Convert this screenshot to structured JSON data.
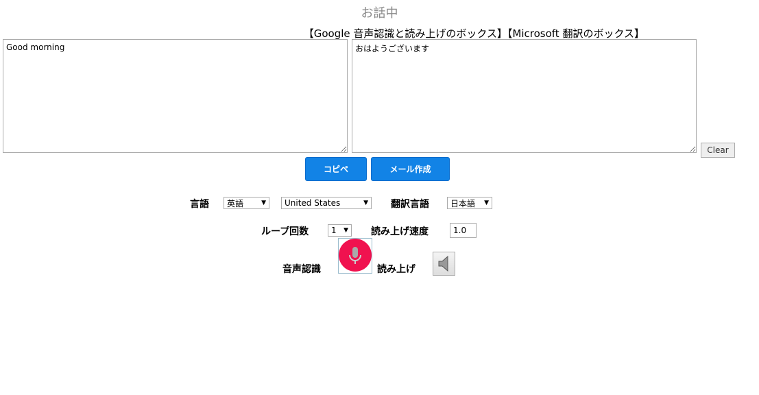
{
  "status": "お話中",
  "box_labels": "【Google 音声認識と読み上げのボックス】【Microsoft 翻訳のボックス】",
  "google_box": {
    "value": "Good morning"
  },
  "ms_box": {
    "value": "おはようございます"
  },
  "buttons": {
    "clear": "Clear",
    "copy": "コピペ",
    "mail": "メール作成"
  },
  "settings": {
    "language_label": "言語",
    "language": "英語",
    "region": "United States",
    "translate_label": "翻訳言語",
    "translate_language": "日本語",
    "loop_label": "ループ回数",
    "loop": "1",
    "speed_label": "読み上げ速度",
    "speed": "1.0",
    "recognition_label": "音声認識",
    "readout_label": "読み上げ"
  },
  "colors": {
    "button": "#1283e6",
    "mic": "#f0124f"
  }
}
